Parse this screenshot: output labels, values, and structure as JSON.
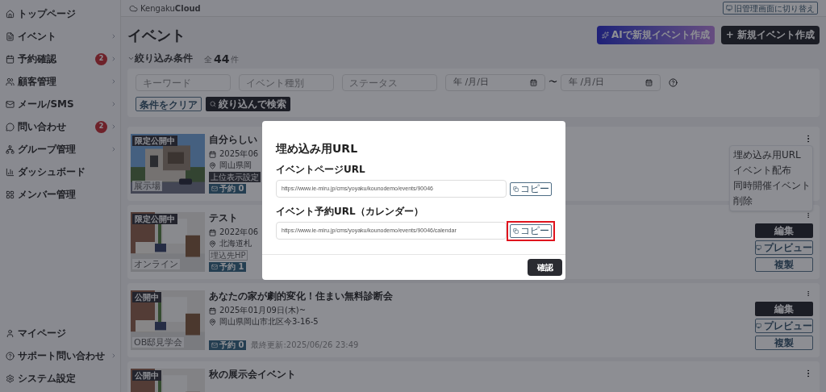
{
  "header": {
    "logo": "Kengaku**Cloud**",
    "switch_button": "旧管理画面に切り替え"
  },
  "sidebar": {
    "items": [
      {
        "label": "トップページ",
        "has_submenu": false
      },
      {
        "label": "イベント",
        "has_submenu": true
      },
      {
        "label": "予約確認",
        "badge": "2",
        "has_submenu": true
      },
      {
        "label": "顧客管理",
        "has_submenu": true
      },
      {
        "label": "メール/SMS",
        "has_submenu": true
      },
      {
        "label": "問い合わせ",
        "badge": "2",
        "has_submenu": true
      },
      {
        "label": "グループ管理",
        "has_submenu": true
      },
      {
        "label": "ダッシュボード",
        "has_submenu": false
      },
      {
        "label": "メンバー管理",
        "has_submenu": false
      }
    ],
    "bottom_items": [
      {
        "label": "マイページ",
        "has_submenu": false
      },
      {
        "label": "サポート問い合わせ",
        "has_submenu": true
      },
      {
        "label": "システム設定",
        "has_submenu": false
      }
    ]
  },
  "page": {
    "title": "イベント",
    "ai_button": "AIで新規イベント作成",
    "new_button": "+ 新規イベント作成"
  },
  "filter": {
    "toggle": "絞り込み条件",
    "total_prefix": "全",
    "total": "44",
    "total_suffix": "件",
    "fields": [
      {
        "placeholder": "キーワード"
      },
      {
        "placeholder": "イベント種別"
      },
      {
        "placeholder": "ステータス"
      }
    ],
    "date_from": "年 /月/日",
    "date_sep": "〜",
    "date_to": "年 /月/日",
    "clear_button": "条件をクリア",
    "search_button": "絞り込んで検索"
  },
  "events": [
    {
      "status": "限定公開中",
      "type": "展示場",
      "title": "自分らしい",
      "date": "2025年06",
      "location": "岡山県岡",
      "tags": [
        {
          "label": "上位表示設定",
          "kind": "dark"
        }
      ],
      "reservations": "予約 0",
      "menu": [
        "埋め込み用URL",
        "イベント配布",
        "同時開催イベント",
        "削除"
      ]
    },
    {
      "status": "限定公開中",
      "type": "オンライン",
      "title": "テスト",
      "date": "2022年06",
      "location": "北海道札",
      "tags": [
        {
          "label": "埋込先HP",
          "kind": "outline"
        }
      ],
      "reservations": "予約 1",
      "actions": [
        {
          "label": "編集",
          "kind": "primary"
        },
        {
          "label": "プレビュー",
          "kind": "preview"
        },
        {
          "label": "複製",
          "kind": "outline"
        }
      ]
    },
    {
      "status": "公開中",
      "type": "OB邸見学会",
      "title": "あなたの家が劇的変化！住まい無料診断会",
      "date": "2025年01月09日(木)~",
      "location": "岡山県岡山市北区今3-16-5",
      "reservations": "予約 0",
      "updated": "最終更新:2025/06/26 23:49",
      "actions": [
        {
          "label": "編集",
          "kind": "primary"
        },
        {
          "label": "プレビュー",
          "kind": "preview"
        },
        {
          "label": "複製",
          "kind": "outline"
        }
      ]
    },
    {
      "status": "公開中",
      "title": "秋の展示会イベント"
    }
  ],
  "modal": {
    "title": "埋め込み用URL",
    "fields": [
      {
        "label": "イベントページURL",
        "value": "https://www.ie-miru.jp/cms/yoyaku/kounodemo/events/90046",
        "copy": "コピー",
        "highlighted": false
      },
      {
        "label": "イベント予約URL（カレンダー）",
        "value": "https://www.ie-miru.jp/cms/yoyaku/kounodemo/events/90046/calendar",
        "copy": "コピー",
        "highlighted": true
      }
    ],
    "confirm": "確認"
  }
}
